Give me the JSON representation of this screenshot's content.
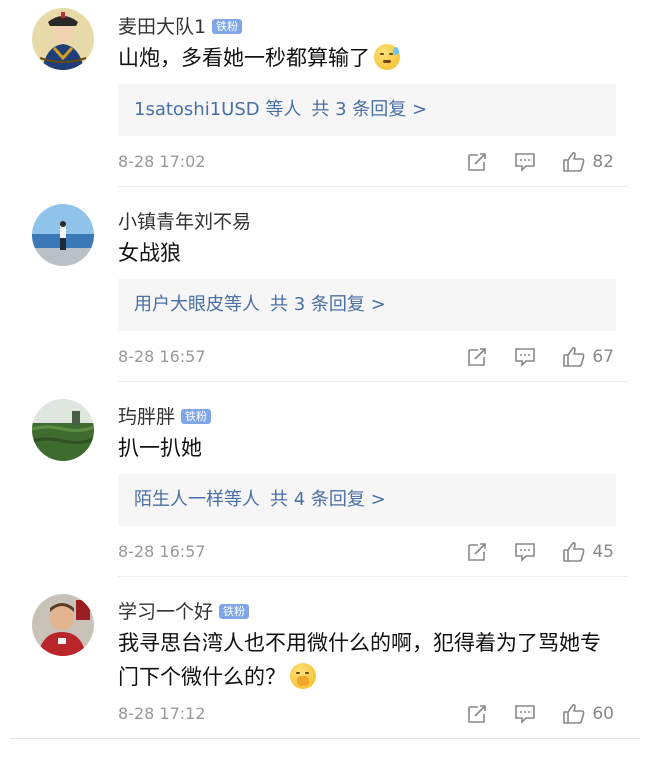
{
  "comments": [
    {
      "username": "麦田大队1",
      "badge": "铁粉",
      "content": "山炮，多看她一秒都算输了",
      "emoji_icon": "sweat-smile-emoji",
      "replies": {
        "users": "1satoshi1USD 等人",
        "count": "共 3 条回复 >"
      },
      "time": "8-28 17:02",
      "likes": "82"
    },
    {
      "username": "小镇青年刘不易",
      "badge": "",
      "content": "女战狼",
      "replies": {
        "users": "用户大眼皮等人",
        "count": "共 3 条回复 >"
      },
      "time": "8-28 16:57",
      "likes": "67"
    },
    {
      "username": "玙胖胖",
      "badge": "铁粉",
      "content": "扒一扒她",
      "replies": {
        "users": "陌生人一样等人",
        "count": "共 4 条回复 >"
      },
      "time": "8-28 16:57",
      "likes": "45"
    },
    {
      "username": "学习一个好",
      "badge": "铁粉",
      "content": "我寻思台湾人也不用微什么的啊，犯得着为了骂她专门下个微什么的？",
      "emoji_icon": "shush-emoji",
      "time": "8-28 17:12",
      "likes": "60"
    }
  ],
  "icons": {
    "repost": "repost-icon",
    "comment": "comment-icon",
    "like": "thumbs-up-icon"
  },
  "colors": {
    "badge": "#7fa7e8",
    "link": "#4a6fa5",
    "meta": "#999999"
  }
}
